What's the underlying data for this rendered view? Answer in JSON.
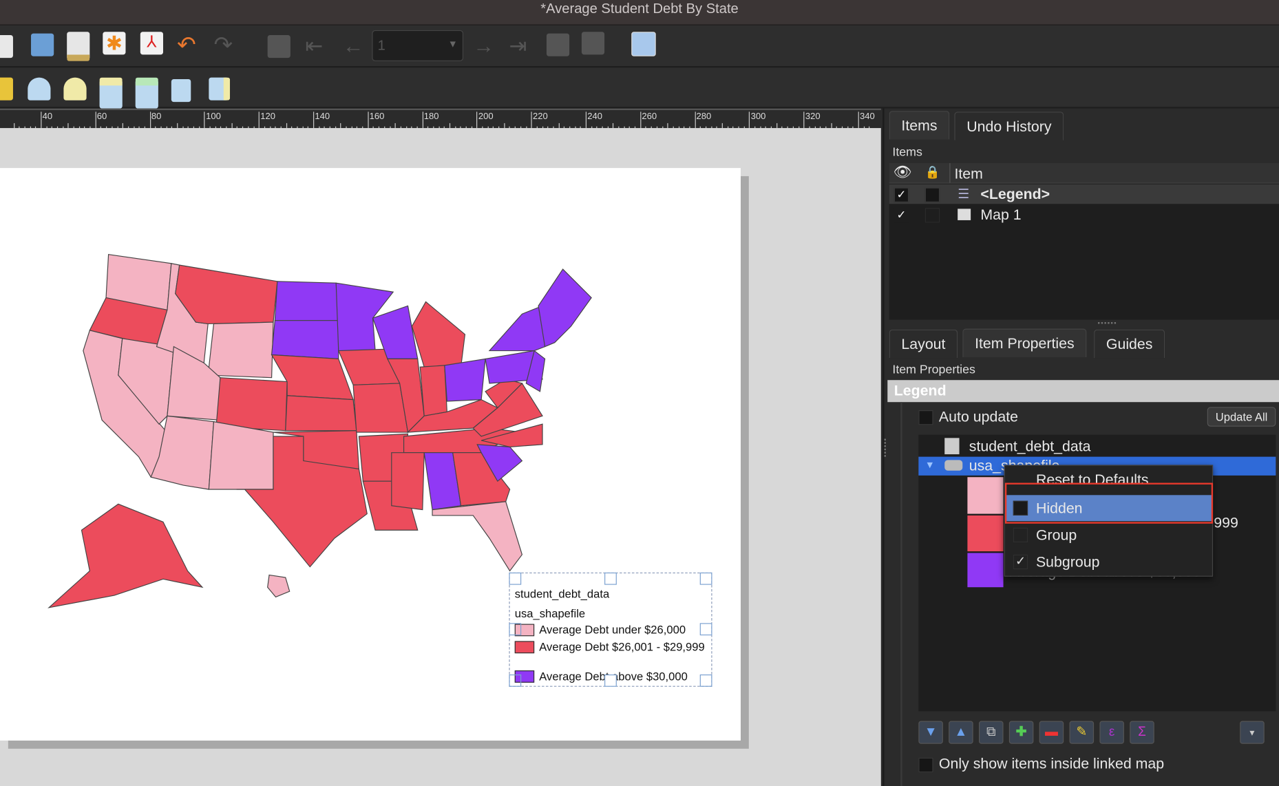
{
  "window": {
    "title": "*Average Student Debt By State"
  },
  "toolbar": {
    "page_value": "1"
  },
  "ruler": {
    "labels": [
      "40",
      "60",
      "80",
      "100",
      "120",
      "140",
      "160",
      "180",
      "200",
      "220",
      "240",
      "260",
      "280",
      "300",
      "320",
      "340"
    ]
  },
  "map": {
    "colors": {
      "low": "#f4b3c2",
      "mid": "#ec4c5c",
      "high": "#9039f5"
    }
  },
  "legend_item": {
    "title1": "student_debt_data",
    "title2": "usa_shapefile",
    "entries": [
      {
        "label": "Average Debt under $26,000",
        "color": "#f4b3c2"
      },
      {
        "label": "Average Debt $26,001 - $29,999",
        "color": "#ec4c5c"
      },
      {
        "label": "Average Debt above $30,000",
        "color": "#9039f5"
      }
    ]
  },
  "panel": {
    "tabs_top": [
      "Items",
      "Undo History"
    ],
    "items_label": "Items",
    "items_header": "Item",
    "items": [
      {
        "name": "<Legend>",
        "visible": true,
        "locked": false
      },
      {
        "name": "Map 1",
        "visible": true,
        "locked": false
      }
    ],
    "tabs_bottom": [
      "Layout",
      "Item Properties",
      "Guides"
    ],
    "props_label": "Item Properties",
    "section": "Legend",
    "auto_update": "Auto update",
    "update_all": "Update All",
    "tree": {
      "layer1": "student_debt_data",
      "layer2": "usa_shapefile",
      "partial_label_end": "999",
      "partial_label_bottom": "Average Debt above $30,000"
    },
    "context_menu": [
      {
        "label": "Reset to Defaults"
      },
      {
        "label": "Hidden",
        "checked": false,
        "highlighted": true
      },
      {
        "label": "Group",
        "checked": false
      },
      {
        "label": "Subgroup",
        "checked": true
      }
    ],
    "only_inside": "Only show items inside linked map",
    "selection_color": "#2f6ad8",
    "highlight_border": "#e8392c"
  }
}
